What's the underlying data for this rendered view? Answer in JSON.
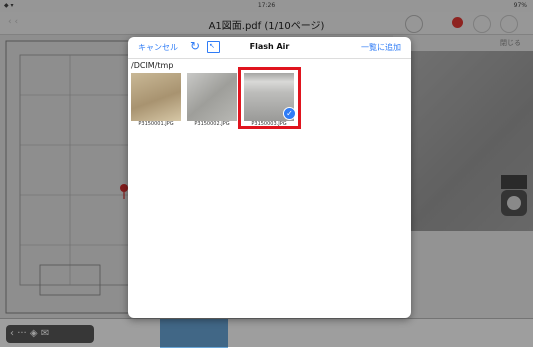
{
  "statusbar": {
    "time": "17:26",
    "battery": "97%"
  },
  "app": {
    "title": "A1図面.pdf (1/10ページ)"
  },
  "right_pane": {
    "header": "閉じる"
  },
  "dialog": {
    "cancel_label": "キャンセル",
    "title": "Flash Air",
    "add_all_label": "一覧に追加",
    "folder_path": "/DCIM/tmp",
    "files": [
      {
        "name": "P3150001.JPG",
        "selected": false
      },
      {
        "name": "P3150002.JPG",
        "selected": false
      },
      {
        "name": "P3150003.JPG",
        "selected": true
      }
    ]
  },
  "colors": {
    "accent": "#2f7cf6",
    "highlight": "#e0141e",
    "badge": "#e53935"
  }
}
